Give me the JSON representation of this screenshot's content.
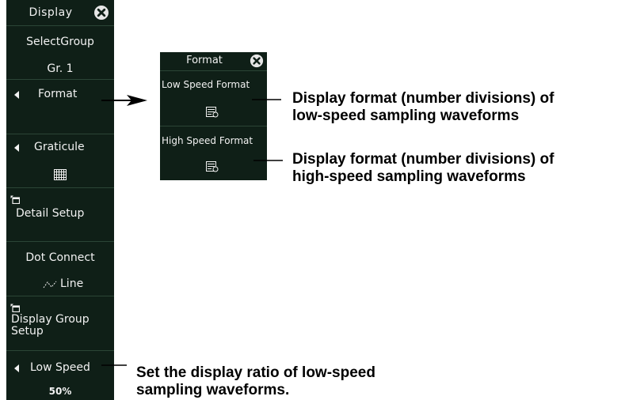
{
  "display_menu": {
    "title": "Display",
    "select_group_label": "SelectGroup",
    "select_group_value": "Gr. 1",
    "format_label": "Format",
    "graticule_label": "Graticule",
    "detail_setup_label": "Detail Setup",
    "dot_connect_label": "Dot Connect",
    "dot_connect_value": "Line",
    "display_group_setup_line1": "Display Group",
    "display_group_setup_line2": "Setup",
    "low_speed_label": "Low Speed",
    "low_speed_value": "50%"
  },
  "format_menu": {
    "title": "Format",
    "low_speed_format_label": "Low Speed Format",
    "high_speed_format_label": "High Speed Format"
  },
  "callouts": {
    "low_format_line1": "Display format (number divisions) of",
    "low_format_line2": "low-speed sampling waveforms",
    "high_format_line1": "Display format (number divisions) of",
    "high_format_line2": "high-speed sampling waveforms",
    "ratio_line1": "Set the display ratio of low-speed",
    "ratio_line2": "sampling waveforms."
  },
  "colors": {
    "panel_background": "#0f1f17",
    "panel_text": "#f2f2f2",
    "annotation": "#000000"
  }
}
